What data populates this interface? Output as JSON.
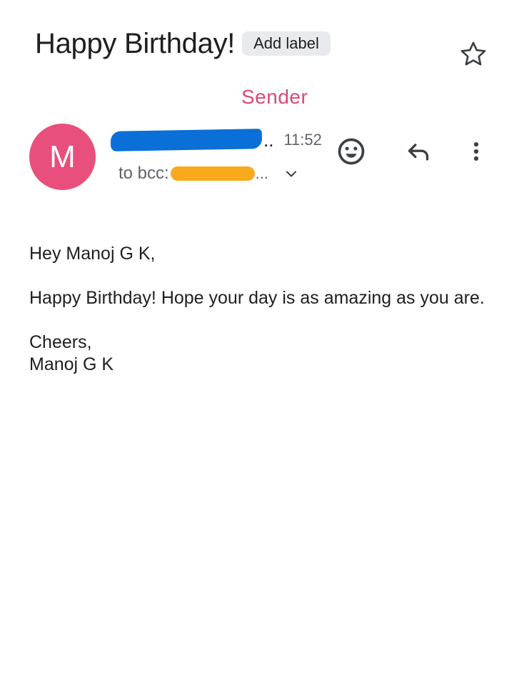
{
  "message": {
    "subject": "Happy Birthday!",
    "add_label": "Add label",
    "sender_annotation": "Sender",
    "avatar_letter": "M",
    "sender_suffix": "..",
    "time": "11:52",
    "to_label": "to bcc:",
    "recipient_suffix": "...",
    "body": {
      "greeting": "Hey Manoj G K,",
      "paragraph": "Happy Birthday! Hope your day is as amazing as you are.",
      "closing": "Cheers,",
      "signature": "Manoj G K"
    }
  },
  "icons": {
    "star": "star-outline-icon",
    "emoji": "add-reaction-icon",
    "reply": "reply-icon",
    "more": "more-vert-icon",
    "expand": "chevron-down-icon"
  },
  "colors": {
    "avatar_bg": "#e94f7c",
    "sender_annotation": "#d9477b",
    "redaction_blue": "#0a6fd6",
    "redaction_orange": "#f9a91c",
    "label_chip_bg": "#e8eaed"
  }
}
